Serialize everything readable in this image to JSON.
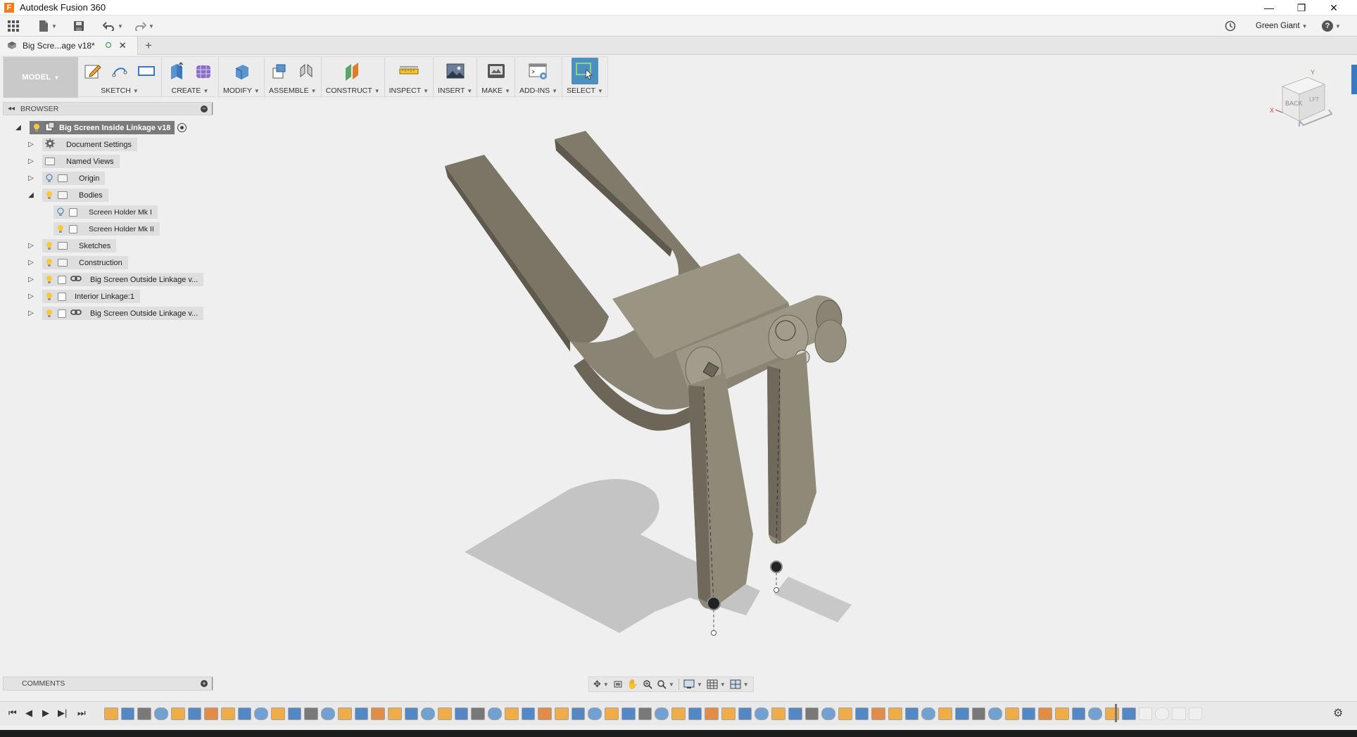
{
  "window": {
    "app_title": "Autodesk Fusion 360",
    "app_icon_letter": "F",
    "minimize": "—",
    "restore": "❐",
    "close": "✕"
  },
  "quickbar": {
    "user_name": "Green Giant",
    "help_label": "?"
  },
  "document_tab": {
    "title": "Big Scre...age v18*",
    "add_tab": "+"
  },
  "toolbar": {
    "mode": "MODEL",
    "groups": [
      "SKETCH",
      "CREATE",
      "MODIFY",
      "ASSEMBLE",
      "CONSTRUCT",
      "INSPECT",
      "INSERT",
      "MAKE",
      "ADD-INS",
      "SELECT"
    ]
  },
  "browser": {
    "title": "BROWSER",
    "root": "Big Screen Inside Linkage v18",
    "items": [
      {
        "label": "Document Settings"
      },
      {
        "label": "Named Views"
      },
      {
        "label": "Origin"
      },
      {
        "label": "Bodies"
      },
      {
        "label": "Screen Holder Mk I"
      },
      {
        "label": "Screen Holder Mk II"
      },
      {
        "label": "Sketches"
      },
      {
        "label": "Construction"
      },
      {
        "label": "Big Screen Outside Linkage v..."
      },
      {
        "label": "Interior Linkage:1"
      },
      {
        "label": "Big Screen Outside Linkage v..."
      }
    ]
  },
  "viewcube": {
    "face_back": "BACK",
    "face_left": "LFT",
    "axis_x": "X",
    "axis_y": "Y"
  },
  "comments": {
    "title": "COMMENTS"
  },
  "colors": {
    "accent": "#3a78c2",
    "select_active": "#4d8fbf",
    "model_body": "#8a8474",
    "model_shadow": "#c4c4c4"
  }
}
